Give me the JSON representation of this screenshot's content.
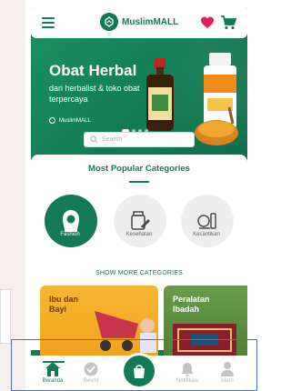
{
  "header": {
    "brand": "MuslimMALL",
    "icons": [
      "menu-icon",
      "heart-icon",
      "cart-icon"
    ],
    "heart_color": "#e21f5b",
    "brand_color": "#127a54"
  },
  "banner": {
    "title": "Obat Herbal",
    "subtitle": "dari herbalist & toko obat terpercaya",
    "brand": "MuslimMALL",
    "dots": 4
  },
  "search": {
    "placeholder": "Search"
  },
  "categories": {
    "title": "Most Popular Categories",
    "items": [
      {
        "label": "Fashion",
        "icon": "hijab-icon",
        "active": true
      },
      {
        "label": "Kesehatan",
        "icon": "health-icon",
        "active": false
      },
      {
        "label": "Kecantikan",
        "icon": "beauty-icon",
        "active": false
      }
    ],
    "show_more": "SHOW MORE CATEGORIES"
  },
  "promos": [
    {
      "title": "Ibu dan Bayi",
      "color": "#f3a21d"
    },
    {
      "title": "Peralatan Ibadah",
      "color": "#4f8035"
    }
  ],
  "bottom_nav": {
    "items": [
      {
        "label": "Beranda",
        "icon": "home-icon",
        "active": true
      },
      {
        "label": "Resmi",
        "icon": "badge-icon",
        "active": false
      },
      {
        "label": "Notifikasi",
        "icon": "bell-icon",
        "active": false
      },
      {
        "label": "Akun",
        "icon": "user-icon",
        "active": false
      }
    ],
    "center_icon": "shopping-bag-icon"
  }
}
